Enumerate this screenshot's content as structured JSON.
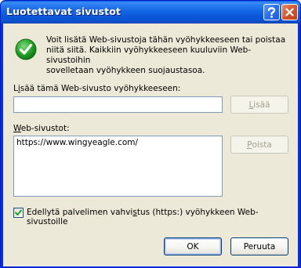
{
  "window": {
    "title": "Luotettavat sivustot"
  },
  "description": {
    "line1": "Voit lisätä Web-sivustoja tähän vyöhykkeeseen tai poistaa",
    "line2": "niitä siitä. Kaikkiin vyöhykkeeseen kuuluviin Web-sivustoihin",
    "line3": "sovelletaan vyöhykkeen suojaustasoa."
  },
  "add_site": {
    "label_pre": "L",
    "label_u": "i",
    "label_post": "sää tämä Web-sivusto vyöhykkeeseen:",
    "value": "",
    "button_pre": "",
    "button_u": "L",
    "button_post": "isää"
  },
  "sites": {
    "label_pre": "",
    "label_u": "W",
    "label_post": "eb-sivustot:",
    "items": [
      "https://www.wingyeagle.com/"
    ],
    "remove_pre": "",
    "remove_u": "P",
    "remove_post": "oista"
  },
  "require_https": {
    "checked": true,
    "label_pre": "Edellytä palvelimen vahvi",
    "label_u": "s",
    "label_post": "tus (https:) vyöhykkeen Web-sivustoille"
  },
  "buttons": {
    "ok": "OK",
    "cancel": "Peruuta"
  },
  "colors": {
    "titlebar": "#0a58d8",
    "face": "#ece9d8",
    "check": "#21a121"
  },
  "icons": {
    "help": "question-mark",
    "close": "x-mark",
    "info": "green-checkmark-circle",
    "checkbox": "checkmark"
  }
}
